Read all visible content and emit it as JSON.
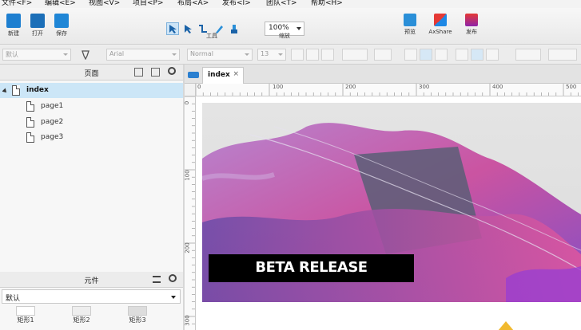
{
  "menu": [
    "文件<F>",
    "编辑<E>",
    "视图<V>",
    "项目<P>",
    "布局<A>",
    "发布<I>",
    "团队<T>",
    "帮助<H>"
  ],
  "toolbar": {
    "new_label": "新建",
    "open_label": "打开",
    "save_label": "保存",
    "tools_group_label": "工具",
    "zoom_group_label": "缩放",
    "zoom_value": "100%",
    "preview_label": "预览",
    "share_label": "AxShare",
    "publish_label": "发布"
  },
  "format_bar": {
    "style_value": "默认",
    "font_value": "Arial",
    "weight_value": "Normal",
    "size_value": "13"
  },
  "pages_panel": {
    "title": "页面",
    "root": "index",
    "pages": [
      "page1",
      "page2",
      "page3"
    ]
  },
  "widgets_panel": {
    "title": "元件",
    "library": "默认",
    "items": [
      "矩形1",
      "矩形2",
      "矩形3"
    ]
  },
  "editor": {
    "tab_name": "index",
    "close_glyph": "×",
    "h_ticks": [
      "0",
      "100",
      "200",
      "300",
      "400",
      "500"
    ],
    "v_ticks": [
      "0",
      "100",
      "200",
      "300"
    ],
    "banner_text": "BETA RELEASE"
  },
  "colors": {
    "accent_blue": "#1e88e5",
    "selection": "#cce6f7",
    "banner_black": "#000000"
  }
}
